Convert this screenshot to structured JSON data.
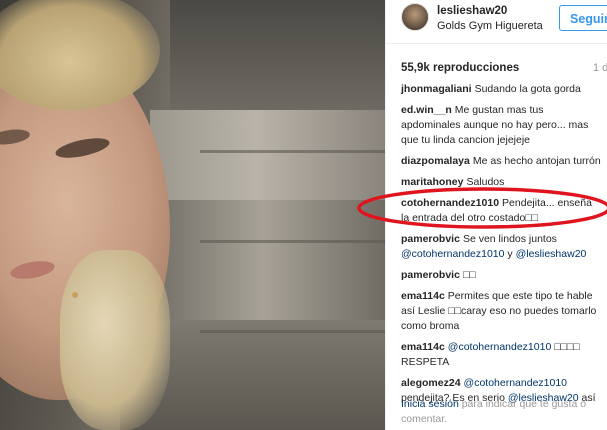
{
  "post": {
    "username": "leslieshaw20",
    "location": "Golds Gym Higuereta",
    "follow_label": "Seguir",
    "views": "55,9k reproducciones",
    "time_ago": "1 d"
  },
  "comments": [
    {
      "user": "jhonmagaliani",
      "text": "Sudando la gota gorda"
    },
    {
      "user": "ed.win__n",
      "text": "Me gustan mas tus apdominales aunque no hay pero... mas que tu linda cancion jejejeje"
    },
    {
      "user": "diazpomalaya",
      "text": "Me as hecho antojan turrón"
    },
    {
      "user": "maritahoney",
      "text": "Saludos"
    },
    {
      "user": "cotohernandez1010",
      "text": "Pendejita... enseña la entrada del otro costado□□"
    },
    {
      "user": "pamerobvic",
      "text_before": "Se ven lindos juntos",
      "mention1": "@cotohernandez1010",
      "joiner": "y",
      "mention2": "@leslieshaw20"
    },
    {
      "user": "pamerobvic",
      "text": "□□"
    },
    {
      "user": "ema114c",
      "text": "Permites que este tipo te hable así Leslie □□caray eso no puedes tomarlo como broma"
    },
    {
      "user": "ema114c",
      "mention": "@cotohernandez1010",
      "text": "□□□□ RESPETA"
    },
    {
      "user": "alegomez24",
      "mention": "@cotohernandez1010",
      "text_mid": "pendejita? Es en serio",
      "mention2": "@leslieshaw20",
      "text_end": "así"
    }
  ],
  "login": {
    "link_label": "Inicia sesión",
    "rest": "para indicar que te gusta o comentar."
  },
  "colors": {
    "accent": "#3897f0",
    "link": "#003569",
    "highlight": "#e0141e"
  }
}
